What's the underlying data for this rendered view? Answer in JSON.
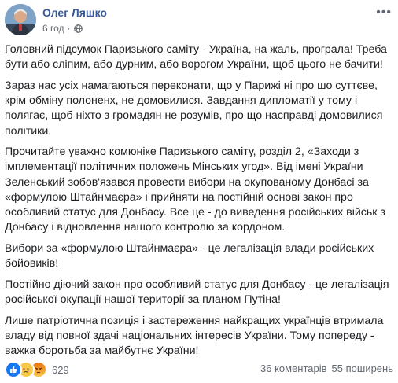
{
  "post": {
    "author": "Олег Ляшко",
    "time": "6 год",
    "separator": "·",
    "paragraphs": [
      "Головний підсумок Паризького саміту - Україна, на жаль, програла! Треба бути або сліпим, або дурним, або ворогом України, щоб цього не бачити!",
      "Зараз нас усіх намагаються переконати, що у Парижі ні про шо суттєве, крім обміну полоненх, не домовилися. Завдання дипломатії у тому і полягає, щоб ніхто з громадян не розумів, про що насправді домовилися політики.",
      "Прочитайте уважно комюніке Паризького саміту, розділ 2, «Заходи з імплементації політичних положень Мінських угод». Від імені України Зеленський зобов'язався провести вибори на окупованому Донбасі за «формулою Штайнмаєра» і прийняти на постійній основі закон про особливий статус для Донбасу. Все це - до виведення російських військ з Донбасу і відновлення нашого контролю за кордоном.",
      "Вибори за «формулою Штайнмаєра» - це легалізація влади російських бойовиків!",
      "Постійно діючий закон про особливий статус для Донбасу - це легалізація російської окупації нашої території за планом Путіна!",
      "Лише патріотична позиція і застереження найкращих українців втримала владу від повної здачі національних інтересів України. Тому попереду - важка боротьба за майбутнє України!"
    ]
  },
  "footer": {
    "reaction_count": "629",
    "comments": "36 коментарів",
    "shares": "55 поширень",
    "reactions": [
      "like",
      "sad",
      "angry"
    ]
  },
  "icons": {
    "privacy": "globe-icon",
    "menu": "more-options-icon"
  },
  "colors": {
    "author": "#385898",
    "like": "#1877f2",
    "meta": "#616770"
  }
}
